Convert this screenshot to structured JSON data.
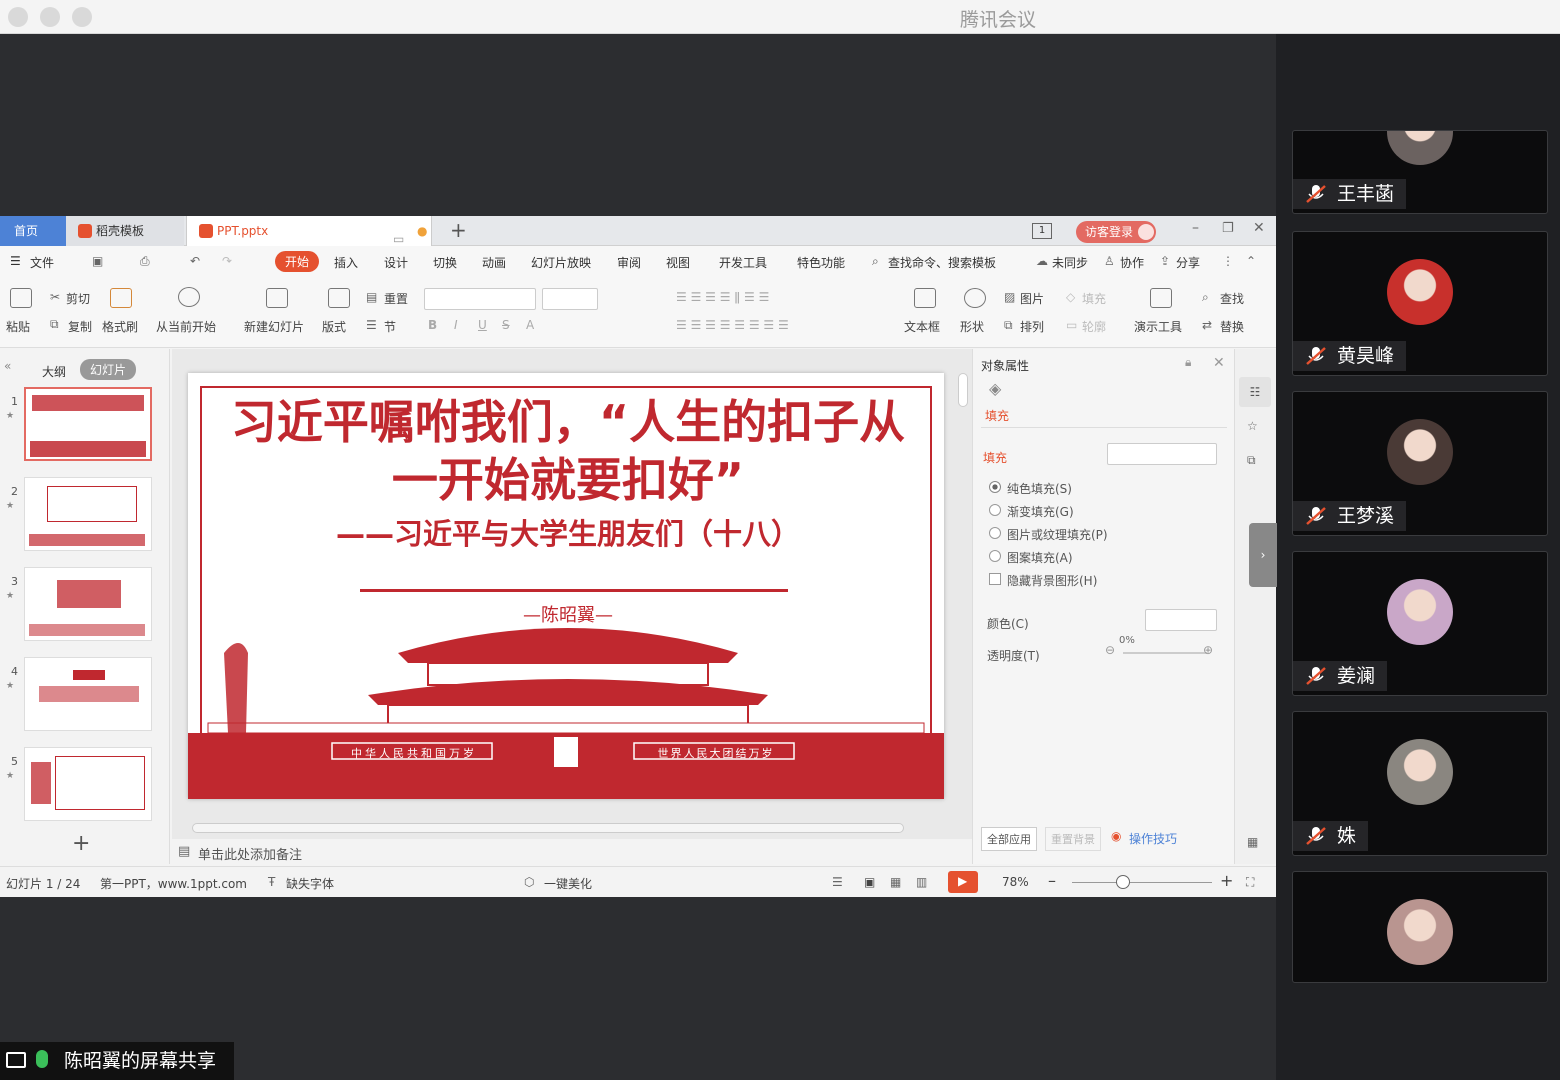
{
  "app": {
    "title": "腾讯会议"
  },
  "wps": {
    "tabs": {
      "home": "首页",
      "daoke": "稻壳模板",
      "file": "PPT.pptx",
      "page_count": "1",
      "login": "访客登录"
    },
    "menu": {
      "file": "文件",
      "start": "开始",
      "insert": "插入",
      "design": "设计",
      "switch": "切换",
      "animation": "动画",
      "slideshow": "幻灯片放映",
      "review": "审阅",
      "view": "视图",
      "dev": "开发工具",
      "special": "特色功能",
      "search": "查找命令、搜索模板",
      "unsynced": "未同步",
      "collab": "协作",
      "share": "分享"
    },
    "toolbar": {
      "paste": "粘贴",
      "cut": "剪切",
      "copy": "复制",
      "format_painter": "格式刷",
      "from_current": "从当前开始",
      "new_slide": "新建幻灯片",
      "layout": "版式",
      "reset": "重置",
      "section": "节",
      "textbox": "文本框",
      "shape": "形状",
      "picture": "图片",
      "arrange": "排列",
      "fill": "填充",
      "outline": "轮廓",
      "present_tool": "演示工具",
      "find": "查找",
      "replace": "替换"
    },
    "leftpane": {
      "outline_tab": "大纲",
      "slides_tab": "幻灯片",
      "thumbs": [
        "1",
        "2",
        "3",
        "4",
        "5"
      ],
      "add": "+"
    },
    "slide": {
      "title": "习近平嘱咐我们，“人生的扣子从一开始就要扣好”",
      "subtitle": "——习近平与大学生朋友们（十八）",
      "author": "—陈昭翼—",
      "banner_left": "中华人民共和国万岁",
      "banner_right": "世界人民大团结万岁"
    },
    "props": {
      "header": "对象属性",
      "tab_fill": "填充",
      "section_fill": "填充",
      "solid": "纯色填充(S)",
      "gradient": "渐变填充(G)",
      "picture": "图片或纹理填充(P)",
      "pattern": "图案填充(A)",
      "hide_bg": "隐藏背景图形(H)",
      "color": "颜色(C)",
      "transparency": "透明度(T)",
      "transparency_value": "0%",
      "apply_all": "全部应用",
      "reset_bg": "重置背景",
      "tips": "操作技巧"
    },
    "notes": "单击此处添加备注",
    "status": {
      "slide_index": "幻灯片 1 / 24",
      "theme": "第一PPT，www.1ppt.com",
      "missing_font": "缺失字体",
      "beautify": "一键美化",
      "zoom": "78%"
    }
  },
  "participants": [
    {
      "name": "王丰菡",
      "avatar_color": "#6b6260"
    },
    {
      "name": "黄昊峰",
      "avatar_color": "#c8302c"
    },
    {
      "name": "王梦溪",
      "avatar_color": "#4a3a36"
    },
    {
      "name": "姜澜",
      "avatar_color": "#c9a7c8"
    },
    {
      "name": "姝",
      "avatar_color": "#8a8680"
    },
    {
      "name": "",
      "avatar_color": "#b99590"
    }
  ],
  "share_banner": "陈昭翼的屏幕共享",
  "colors": {
    "accent": "#e5512f",
    "slide_red": "#c0282f",
    "tencent_bg": "#2c2d30"
  }
}
